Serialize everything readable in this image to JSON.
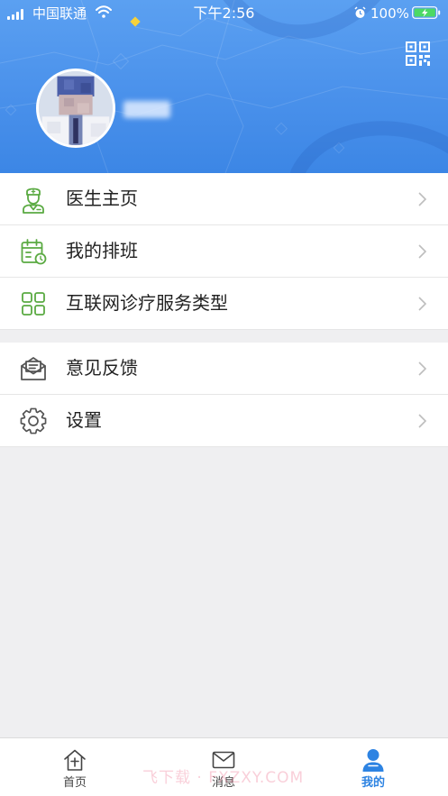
{
  "status_bar": {
    "carrier": "中国联通",
    "time": "下午2:56",
    "battery": "100%",
    "icons": [
      "signal-icon",
      "wifi-icon",
      "alarm-icon",
      "battery-charging-icon"
    ]
  },
  "header": {
    "qr_icon": "qr-code-icon",
    "avatar": "doctor-avatar"
  },
  "menu": {
    "groups": [
      {
        "items": [
          {
            "label": "医生主页",
            "icon": "doctor-icon"
          },
          {
            "label": "我的排班",
            "icon": "calendar-icon"
          },
          {
            "label": "互联网诊疗服务类型",
            "icon": "grid-icon"
          }
        ]
      },
      {
        "items": [
          {
            "label": "意见反馈",
            "icon": "feedback-envelope-icon"
          },
          {
            "label": "设置",
            "icon": "gear-icon"
          }
        ]
      }
    ]
  },
  "tabbar": {
    "tabs": [
      {
        "label": "首页",
        "icon": "home-icon",
        "active": false
      },
      {
        "label": "消息",
        "icon": "mail-icon",
        "active": false
      },
      {
        "label": "我的",
        "icon": "person-icon",
        "active": true
      }
    ]
  },
  "colors": {
    "header_blue": "#4a91eb",
    "accent": "#2d83e2",
    "menu_icon_green": "#5aaa42",
    "menu_icon_gray": "#555555",
    "battery_green": "#4cd964"
  },
  "watermark": {
    "text": "飞下载 · FXZXY.COM"
  }
}
